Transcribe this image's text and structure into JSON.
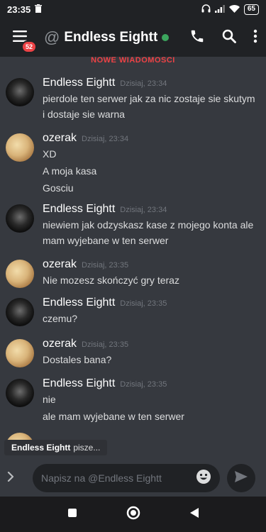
{
  "status_bar": {
    "time": "23:35",
    "battery": "65"
  },
  "header": {
    "badge_count": "52",
    "channel_title": "Endless Eightt",
    "at_symbol": "@",
    "status_color": "#3ba55d"
  },
  "new_messages_banner": "NOWE WIADOMOŚCI",
  "messages": [
    {
      "author": "Endless Eightt",
      "avatar": "dark",
      "time": "Dzisiaj, 23:34",
      "lines": [
        "pierdole ten serwer jak za nic zostaje sie skutym i dostaje sie warna"
      ]
    },
    {
      "author": "ozerak",
      "avatar": "light",
      "time": "Dzisiaj, 23:34",
      "lines": [
        "XD",
        "A moja kasa",
        "Gosciu"
      ]
    },
    {
      "author": "Endless Eightt",
      "avatar": "dark",
      "time": "Dzisiaj, 23:34",
      "lines": [
        "niewiem jak odzyskasz kase z mojego konta ale mam wyjebane w ten serwer"
      ]
    },
    {
      "author": "ozerak",
      "avatar": "light",
      "time": "Dzisiaj, 23:35",
      "lines": [
        "Nie mozesz skończyć gry teraz"
      ]
    },
    {
      "author": "Endless Eightt",
      "avatar": "dark",
      "time": "Dzisiaj, 23:35",
      "lines": [
        "czemu?"
      ]
    },
    {
      "author": "ozerak",
      "avatar": "light",
      "time": "Dzisiaj, 23:35",
      "lines": [
        "Dostales bana?"
      ]
    },
    {
      "author": "Endless Eightt",
      "avatar": "dark",
      "time": "Dzisiaj, 23:35",
      "lines": [
        "nie",
        "ale mam wyjebane w ten serwer"
      ]
    }
  ],
  "typing": {
    "user": "Endless Eightt",
    "suffix": "pisze..."
  },
  "composer": {
    "placeholder": "Napisz na @Endless Eightt"
  },
  "colors": {
    "background": "#36393f",
    "header": "#202225",
    "accent_red": "#ed4245",
    "online": "#3ba55d"
  },
  "icons": [
    "trash-icon",
    "headphones-icon",
    "signal-icon",
    "wifi-icon",
    "battery-icon",
    "menu-icon",
    "phone-icon",
    "search-icon",
    "more-vertical-icon",
    "chevron-right-icon",
    "emoji-icon",
    "send-icon",
    "square-nav-icon",
    "circle-nav-icon",
    "back-nav-icon"
  ]
}
